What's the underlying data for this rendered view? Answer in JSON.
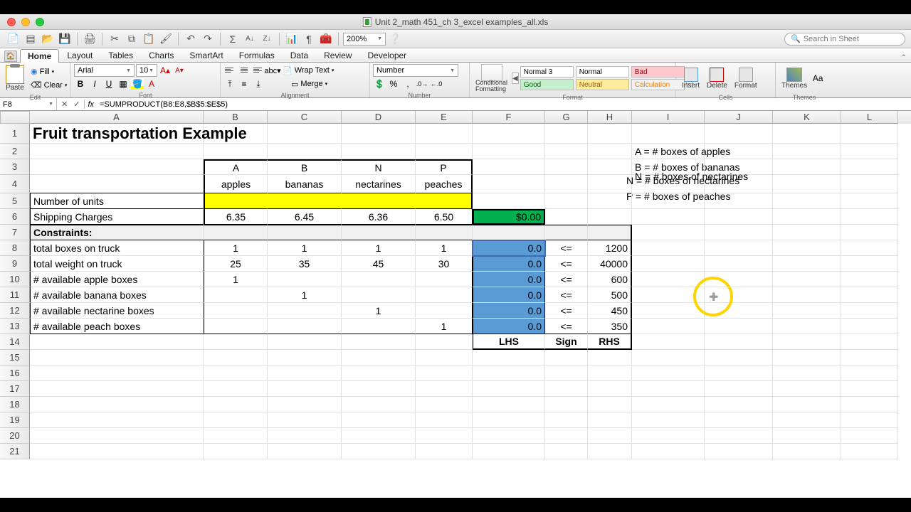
{
  "title": "Unit 2_math 451_ch 3_excel examples_all.xls",
  "search_placeholder": "Search in Sheet",
  "ribbon": {
    "tabs": [
      "Home",
      "Layout",
      "Tables",
      "Charts",
      "SmartArt",
      "Formulas",
      "Data",
      "Review",
      "Developer"
    ],
    "active": "Home",
    "groups": {
      "edit": "Edit",
      "font": "Font",
      "alignment": "Alignment",
      "number": "Number",
      "format": "Format",
      "cells": "Cells",
      "themes": "Themes"
    },
    "paste": "Paste",
    "fill": "Fill",
    "clear": "Clear",
    "font_name": "Arial",
    "font_size": "10",
    "wrap": "Wrap Text",
    "merge": "Merge",
    "number_format": "Number",
    "cf": "Conditional Formatting",
    "styles": {
      "n3": "Normal 3",
      "nm": "Normal",
      "bad": "Bad",
      "good": "Good",
      "neu": "Neutral",
      "calc": "Calculation"
    },
    "insert": "Insert",
    "delete": "Delete",
    "format_btn": "Format",
    "themes": "Themes"
  },
  "zoom": "200%",
  "namebox": "F8",
  "formula": "=SUMPRODUCT(B8:E8,$B$5:$E$5)",
  "columns": [
    "A",
    "B",
    "C",
    "D",
    "E",
    "F",
    "G",
    "H",
    "I",
    "J",
    "K",
    "L"
  ],
  "sheet": {
    "title": "Fruit transportation Example",
    "hdr": {
      "A": "A",
      "B": "B",
      "N": "N",
      "P": "P",
      "apples": "apples",
      "bananas": "bananas",
      "nectarines": "nectarines",
      "peaches": "peaches"
    },
    "labels": {
      "numunits": "Number of units",
      "ship": "Shipping Charges",
      "cons": "Constraints:",
      "c1": "total boxes on truck",
      "c2": "total weight on truck",
      "c3": "# available apple boxes",
      "c4": "# available banana boxes",
      "c5": "# available nectarine boxes",
      "c6": "# available peach boxes",
      "lhs": "LHS",
      "sign": "Sign",
      "rhs": "RHS"
    },
    "ship": {
      "a": "6.35",
      "b": "6.45",
      "n": "6.36",
      "p": "6.50",
      "tot": "$0.00"
    },
    "cons": {
      "r8": {
        "a": "1",
        "b": "1",
        "n": "1",
        "p": "1",
        "lhs": "0.0",
        "s": "<=",
        "rhs": "1200"
      },
      "r9": {
        "a": "25",
        "b": "35",
        "n": "45",
        "p": "30",
        "lhs": "0.0",
        "s": "<=",
        "rhs": "40000"
      },
      "r10": {
        "a": "1",
        "lhs": "0.0",
        "s": "<=",
        "rhs": "600"
      },
      "r11": {
        "b": "1",
        "lhs": "0.0",
        "s": "<=",
        "rhs": "500"
      },
      "r12": {
        "n": "1",
        "lhs": "0.0",
        "s": "<=",
        "rhs": "450"
      },
      "r13": {
        "p": "1",
        "lhs": "0.0",
        "s": "<=",
        "rhs": "350"
      }
    },
    "legend": {
      "a": "A = # boxes of apples",
      "b": "B = # boxes of bananas",
      "n": "N = # boxes of nectarines",
      "p": "P = # boxes of peaches"
    }
  }
}
